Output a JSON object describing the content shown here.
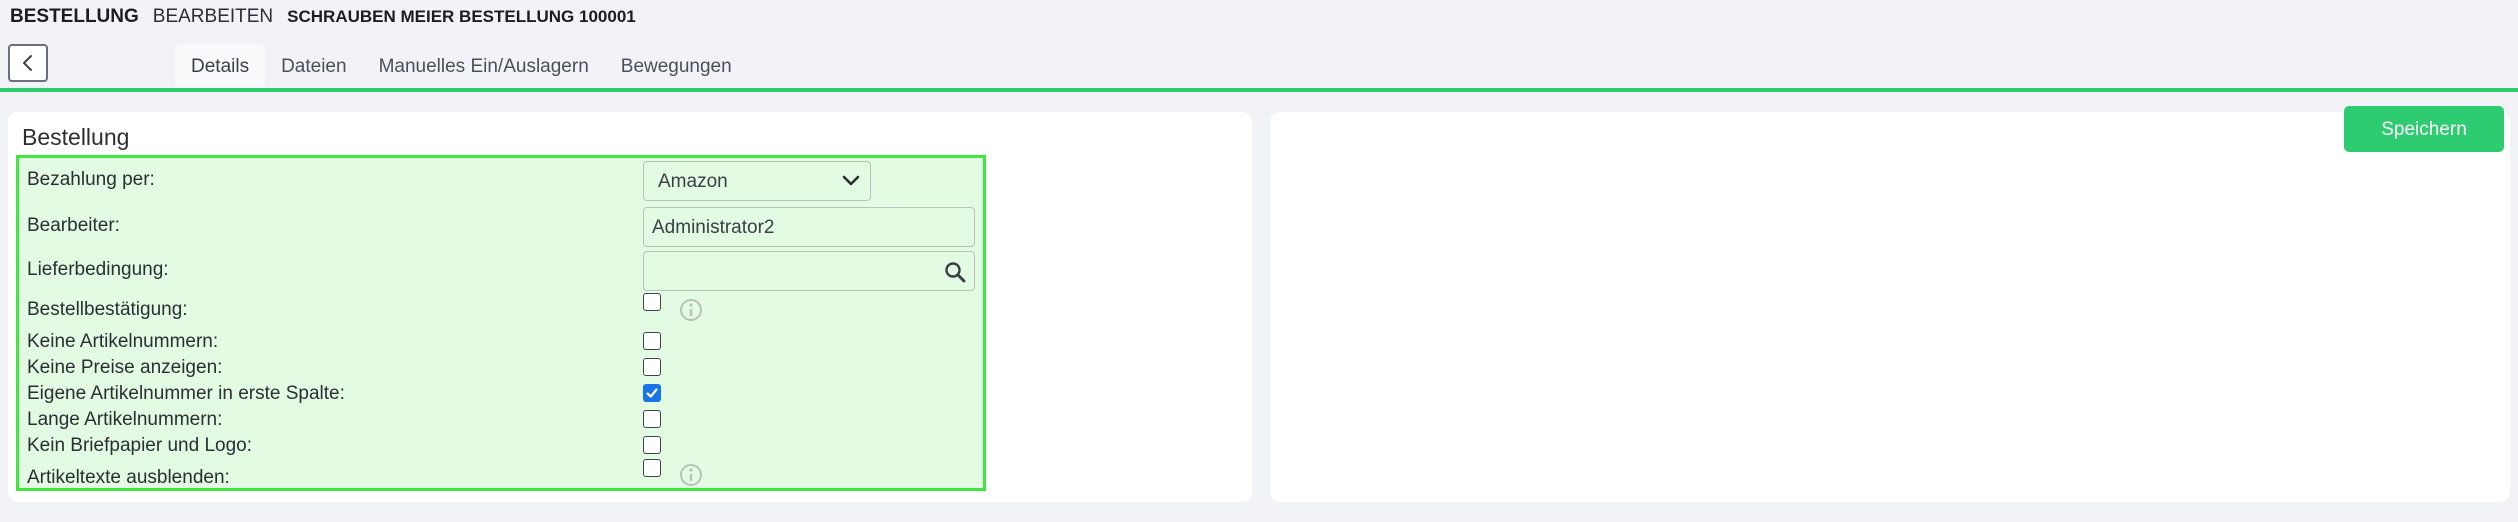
{
  "header": {
    "breadcrumb": {
      "section": "BESTELLUNG",
      "action": "BEARBEITEN",
      "title": "SCHRAUBEN MEIER BESTELLUNG 100001"
    },
    "back_icon": "chevron-left-icon",
    "tabs": [
      {
        "label": "Details",
        "active": true
      },
      {
        "label": "Dateien",
        "active": false
      },
      {
        "label": "Manuelles Ein/Auslagern",
        "active": false
      },
      {
        "label": "Bewegungen",
        "active": false
      }
    ],
    "accent_color": "#2ecc71"
  },
  "toolbar": {
    "save_label": "Speichern"
  },
  "form": {
    "section_title": "Bestellung",
    "highlight_color": "#3ee63e",
    "payment": {
      "label": "Bezahlung per:",
      "value": "Amazon"
    },
    "processor": {
      "label": "Bearbeiter:",
      "value": "Administrator2"
    },
    "delivery": {
      "label": "Lieferbedingung:",
      "value": "",
      "icon": "search-icon"
    },
    "checkboxes": [
      {
        "label": "Bestellbestätigung:",
        "checked": false,
        "info": true
      },
      {
        "label": "Keine Artikelnummern:",
        "checked": false,
        "info": false
      },
      {
        "label": "Keine Preise anzeigen:",
        "checked": false,
        "info": false
      },
      {
        "label": "Eigene Artikelnummer in erste Spalte:",
        "checked": true,
        "info": false
      },
      {
        "label": "Lange Artikelnummern:",
        "checked": false,
        "info": false
      },
      {
        "label": "Kein Briefpapier und Logo:",
        "checked": false,
        "info": false
      },
      {
        "label": "Artikeltexte ausblenden:",
        "checked": false,
        "info": true
      }
    ]
  }
}
